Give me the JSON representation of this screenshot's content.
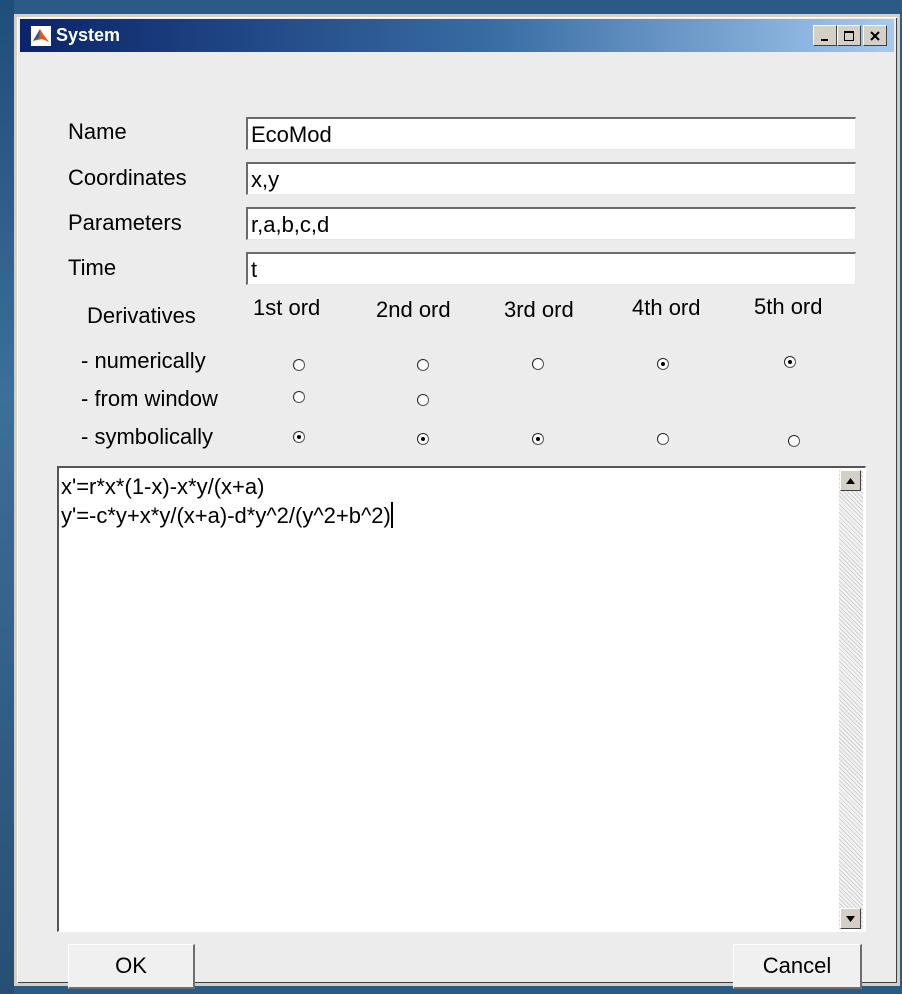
{
  "window": {
    "title": "System"
  },
  "fields": {
    "name": {
      "label": "Name",
      "value": "EcoMod"
    },
    "coordinates": {
      "label": "Coordinates",
      "value": "x,y"
    },
    "parameters": {
      "label": "Parameters",
      "value": "r,a,b,c,d"
    },
    "time": {
      "label": "Time",
      "value": "t"
    }
  },
  "derivatives": {
    "label": "Derivatives",
    "columns": [
      "1st ord",
      "2nd ord",
      "3rd ord",
      "4th ord",
      "5th ord"
    ],
    "rows": [
      {
        "label": "- numerically",
        "selected": [
          false,
          false,
          false,
          true,
          true
        ]
      },
      {
        "label": "- from window",
        "selected": [
          false,
          false
        ]
      },
      {
        "label": "- symbolically",
        "selected": [
          true,
          true,
          true,
          false,
          false
        ]
      }
    ]
  },
  "equations": {
    "lines": [
      "x'=r*x*(1-x)-x*y/(x+a)",
      "y'=-c*y+x*y/(x+a)-d*y^2/(y^2+b^2)"
    ]
  },
  "buttons": {
    "ok": "OK",
    "cancel": "Cancel"
  }
}
